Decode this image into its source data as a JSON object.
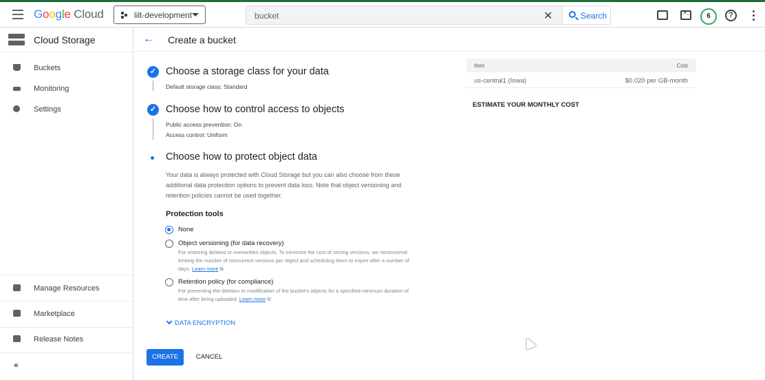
{
  "topbar": {
    "logo": {
      "g": "G",
      "o1": "o",
      "o2": "o",
      "g2": "g",
      "l": "l",
      "e": "e",
      "cloud": "Cloud"
    },
    "project": "lilt-development",
    "search_value": "bucket",
    "search_button": "Search",
    "notification_count": "6"
  },
  "sidebar": {
    "product": "Cloud Storage",
    "items": [
      {
        "label": "Buckets",
        "icon": "bucket-icon"
      },
      {
        "label": "Monitoring",
        "icon": "chart-icon"
      },
      {
        "label": "Settings",
        "icon": "gear-icon"
      }
    ],
    "bottom_items": [
      {
        "label": "Manage Resources",
        "icon": "folder-icon"
      },
      {
        "label": "Marketplace",
        "icon": "cart-icon"
      },
      {
        "label": "Release Notes",
        "icon": "notes-icon"
      }
    ],
    "collapse": "«"
  },
  "header": {
    "title": "Create a bucket"
  },
  "steps": [
    {
      "title": "Choose a storage class for your data",
      "subs": [
        "Default storage class: Standard"
      ]
    },
    {
      "title": "Choose how to control access to objects",
      "subs": [
        "Public access prevention: On",
        "Access control: Uniform"
      ]
    },
    {
      "title": "Choose how to protect object data"
    }
  ],
  "protect": {
    "description": "Your data is always protected with Cloud Storage but you can also choose from these additional data protection options to prevent data loss. Note that object versioning and retention policies cannot be used together.",
    "tools_heading": "Protection tools",
    "options": [
      {
        "label": "None",
        "selected": true
      },
      {
        "label": "Object versioning (for data recovery)",
        "help": "For restoring deleted or overwritten objects. To minimize the cost of storing versions, we recommend limiting the number of noncurrent versions per object and scheduling them to expire after a number of days.",
        "link": "Learn more"
      },
      {
        "label": "Retention policy (for compliance)",
        "help": "For preventing the deletion or modification of the bucket's objects for a specified minimum duration of time after being uploaded.",
        "link": "Learn more"
      }
    ],
    "encryption": "DATA ENCRYPTION"
  },
  "actions": {
    "create": "CREATE",
    "cancel": "CANCEL"
  },
  "cost_table": {
    "headers": [
      "Item",
      "Cost"
    ],
    "rows": [
      {
        "item": "us-central1 (Iowa)",
        "cost": "$0.020 per GB-month"
      }
    ],
    "estimate": "ESTIMATE YOUR MONTHLY COST"
  },
  "colors": {
    "accent": "#1a73e8",
    "top_strip": "#1f6e3a",
    "notification_ring": "#34a853"
  }
}
